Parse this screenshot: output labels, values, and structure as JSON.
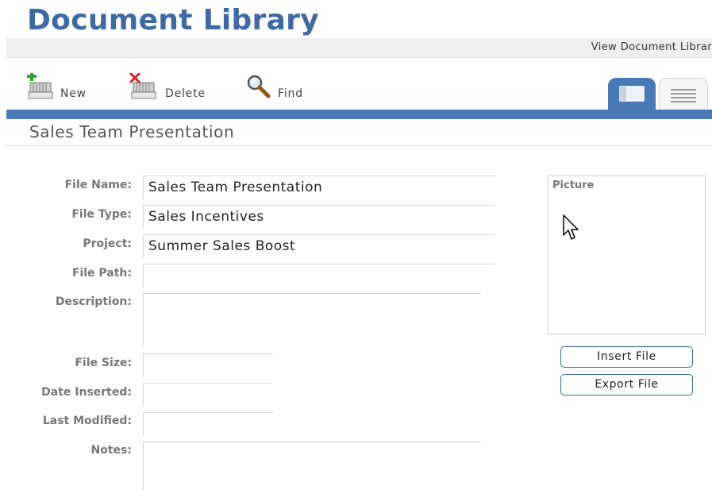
{
  "header": {
    "title": "Document Library"
  },
  "viewbar": {
    "link": "View Document Librar"
  },
  "toolbar": {
    "new_label": "New",
    "delete_label": "Delete",
    "find_label": "Find"
  },
  "record": {
    "title": "Sales Team Presentation"
  },
  "form": {
    "file_name_label": "File Name:",
    "file_name_value": "Sales Team Presentation",
    "file_type_label": "File Type:",
    "file_type_value": "Sales Incentives",
    "project_label": "Project:",
    "project_value": "Summer Sales Boost",
    "file_path_label": "File Path:",
    "file_path_value": "",
    "description_label": "Description:",
    "description_value": "",
    "file_size_label": "File Size:",
    "file_size_value": "",
    "date_inserted_label": "Date Inserted:",
    "date_inserted_value": "",
    "last_modified_label": "Last Modified:",
    "last_modified_value": "",
    "notes_label": "Notes:",
    "notes_value": ""
  },
  "picture": {
    "label": "Picture"
  },
  "buttons": {
    "insert_file": "Insert File",
    "export_file": "Export File"
  },
  "colors": {
    "brand_blue": "#3e6aa4",
    "tab_blue": "#4a7ab5"
  }
}
